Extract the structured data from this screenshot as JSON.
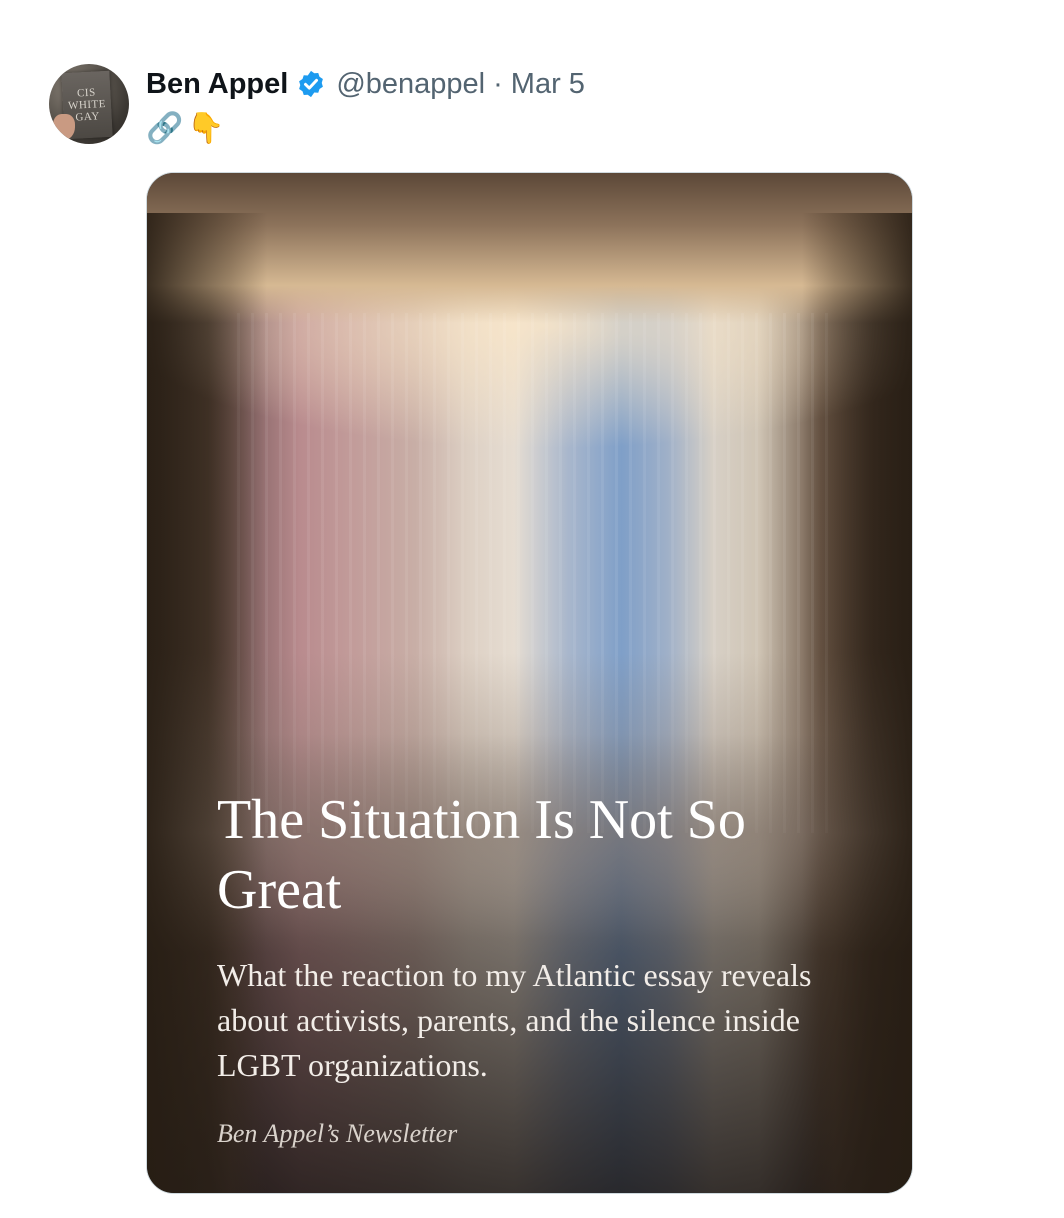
{
  "author": {
    "name": "Ben Appel",
    "handle": "@benappel",
    "separator": "·",
    "date": "Mar 5",
    "verified": true,
    "avatar_book_text": [
      "CIS",
      "WHITE",
      "GAY"
    ]
  },
  "tweet": {
    "text_emojis": [
      "🔗",
      "👇"
    ]
  },
  "card": {
    "title": "The Situation Is Not So Great",
    "subtitle": "What the reaction to my Atlantic essay reveals about activists, parents, and the silence inside LGBT organizations.",
    "publication": "Ben Appel’s Newsletter"
  },
  "colors": {
    "verified_badge": "#1d9bf0",
    "name_text": "#0f1419",
    "secondary_text": "#536471"
  }
}
